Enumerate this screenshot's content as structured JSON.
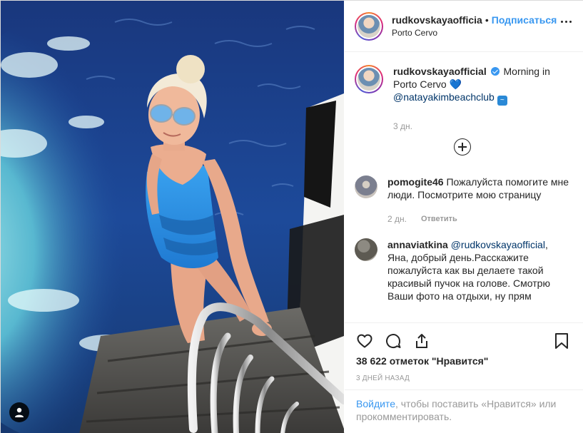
{
  "header": {
    "username": "rudkovskayaofficia",
    "separator": "•",
    "follow_label": "Подписаться",
    "location": "Porto Cervo",
    "more_icon": "more-horizontal-icon"
  },
  "caption": {
    "username": "rudkovskayaofficial",
    "text": "Morning in Porto Cervo",
    "heart_emoji": "💙",
    "mention": "@natayakimbeachclub",
    "wave_emoji": "🌊",
    "time": "3 дн."
  },
  "load_more_icon": "plus-circle-icon",
  "comments": [
    {
      "username": "pomogite46",
      "text": "Пожалуйста помогите мне люди. Посмотрите мою страницу",
      "time": "2 дн.",
      "reply_label": "Ответить"
    },
    {
      "username": "annaviatkina",
      "mention": "@rudkovskayaofficial",
      "text": ", Яна, добрый день.Расскажите пожалуйста как вы делаете такой красивый пучок на голове. Смотрю Ваши фото на отдыхи, ну прям"
    }
  ],
  "actions": {
    "icons": [
      "heart-icon",
      "comment-icon",
      "share-icon",
      "bookmark-icon"
    ],
    "likes_text": "38 622 отметок \"Нравится\"",
    "date_text": "3 дней назад"
  },
  "login_prompt": {
    "link": "Войдите",
    "text": ", чтобы поставить «Нравится» или прокомментировать."
  },
  "colors": {
    "accent": "#3897f0",
    "sea": "#1c3f8a",
    "swimsuit": "#2f8fe0"
  }
}
